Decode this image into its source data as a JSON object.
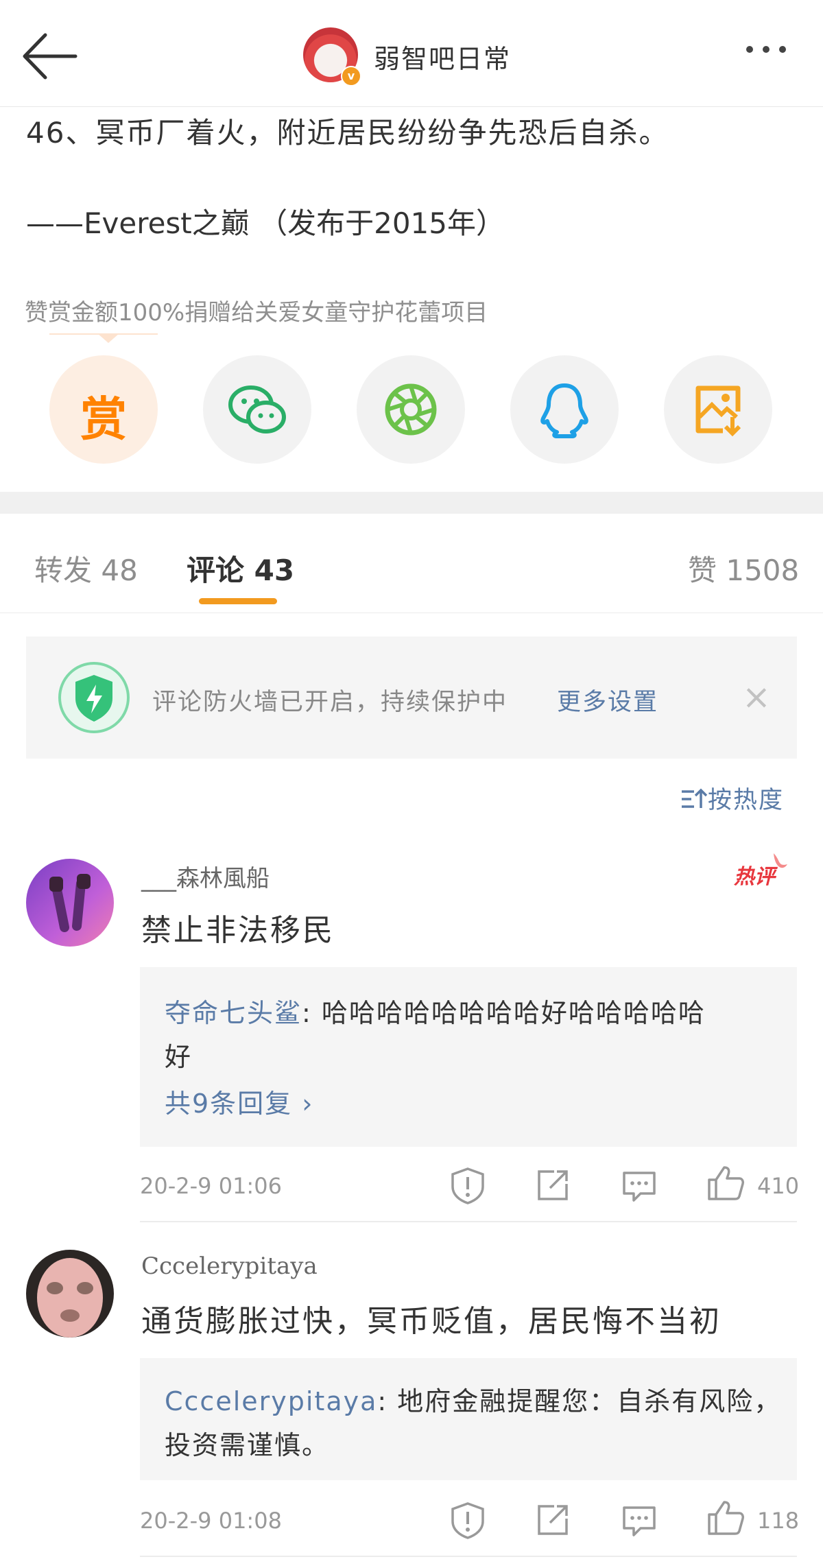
{
  "header": {
    "title": "弱智吧日常"
  },
  "post": {
    "text_line": "46、冥币厂着火，附近居民纷纷争先恐后自杀。",
    "source_line": "——Everest之巅 （发布于2015年）",
    "donate_note": "赞赏金额100%捐赠给关爱女童守护花蕾项目",
    "reward_label": "赏"
  },
  "share_buttons": [
    {
      "icon": "reward-icon"
    },
    {
      "icon": "wechat-icon"
    },
    {
      "icon": "moments-icon"
    },
    {
      "icon": "qq-icon"
    },
    {
      "icon": "save-image-icon"
    }
  ],
  "tabs": {
    "repost": "转发 48",
    "comments": "评论 43",
    "likes": "赞 1508"
  },
  "firewall": {
    "text": "评论防火墙已开启，持续保护中",
    "link": "更多设置",
    "close": "×"
  },
  "sort": {
    "label": "按热度"
  },
  "comments": [
    {
      "user": "___森林風船",
      "text": "禁止非法移民",
      "hot_badge": "热评",
      "reply_user": "夺命七头鲨",
      "reply_text_1": ": 哈哈哈哈哈哈哈哈好哈哈哈哈哈",
      "reply_text_2": "好",
      "more_replies": "共9条回复 ›",
      "time": "20-2-9 01:06",
      "likes": "410"
    },
    {
      "user": "Cccelerypitaya",
      "text": "通货膨胀过快，冥币贬值，居民悔不当初",
      "reply_user": "Cccelerypitaya",
      "reply_text_1": ": 地府金融提醒您：自杀有风险，",
      "reply_text_2": "投资需谨慎。",
      "time": "20-2-9 01:08",
      "likes": "118"
    }
  ],
  "colors": {
    "accent_orange": "#ff8200",
    "link_blue": "#5a7ba7",
    "hot_red": "#e8373e",
    "shield_green": "#35c27a"
  }
}
